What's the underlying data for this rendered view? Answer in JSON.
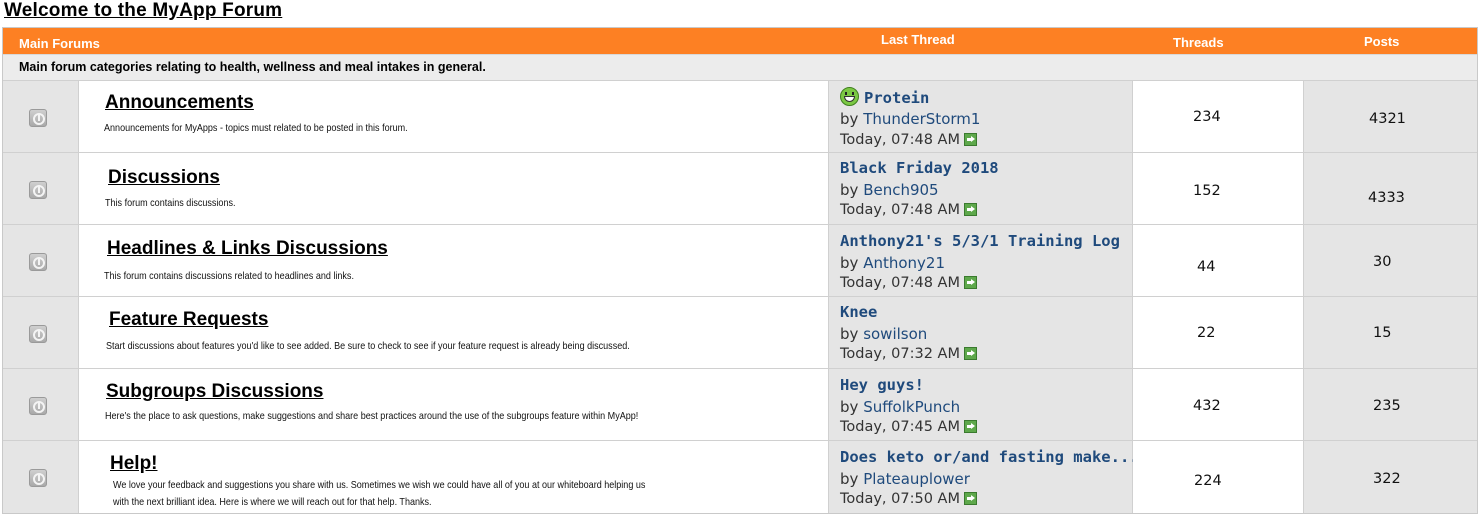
{
  "page_title": "Welcome to the MyApp Forum",
  "header": {
    "main_forums": "Main Forums",
    "last_thread": "Last Thread",
    "threads": "Threads",
    "posts": "Posts"
  },
  "category_description": "Main forum categories relating to health, wellness and meal intakes in general.",
  "colors": {
    "header_bg": "#fd8023",
    "link_blue": "#1f4a7c",
    "cell_gray": "#e5e5e5"
  },
  "forums": [
    {
      "title": "Announcements",
      "description": "Announcements for MyApps  - topics must related to be posted in this forum.",
      "last_thread": {
        "icon": "grin-smiley-icon",
        "title": "Protein",
        "by_prefix": "by",
        "user": "ThunderStorm1",
        "time": "Today, 07:48 AM"
      },
      "threads": "234",
      "posts": "4321"
    },
    {
      "title": "Discussions",
      "description": "This forum contains discussions.",
      "last_thread": {
        "title": "Black Friday 2018",
        "by_prefix": "by",
        "user": "Bench905",
        "time": "Today, 07:48 AM"
      },
      "threads": "152",
      "posts": "4333"
    },
    {
      "title": "Headlines & Links Discussions",
      "description": "This forum contains discussions related to headlines and links.",
      "last_thread": {
        "title": "Anthony21's 5/3/1 Training Log",
        "by_prefix": "by",
        "user": "Anthony21",
        "time": "Today, 07:48 AM"
      },
      "threads": "44",
      "posts": "30"
    },
    {
      "title": "Feature Requests",
      "description": "Start discussions about features you'd like to see added. Be sure to check to see if your feature request is already being discussed.",
      "last_thread": {
        "title": "Knee",
        "by_prefix": "by",
        "user": "sowilson",
        "time": "Today, 07:32 AM"
      },
      "threads": "22",
      "posts": "15"
    },
    {
      "title": "Subgroups Discussions",
      "description": "Here's the place to ask questions, make suggestions and share best practices around the use of the subgroups feature within MyApp!",
      "last_thread": {
        "title": "Hey guys!",
        "by_prefix": "by",
        "user": "SuffolkPunch",
        "time": "Today, 07:45 AM"
      },
      "threads": "432",
      "posts": "235"
    },
    {
      "title": "Help!",
      "description_line1": "We love your feedback and suggestions you share with us. Sometimes we wish we could have all of you at our whiteboard helping us",
      "description_line2": "with the next brilliant idea. Here is where we will reach out for that help. Thanks.",
      "last_thread": {
        "title": "Does keto or/and fasting make...",
        "by_prefix": "by",
        "user": "Plateauplower",
        "time": "Today, 07:50 AM"
      },
      "threads": "224",
      "posts": "322"
    }
  ]
}
